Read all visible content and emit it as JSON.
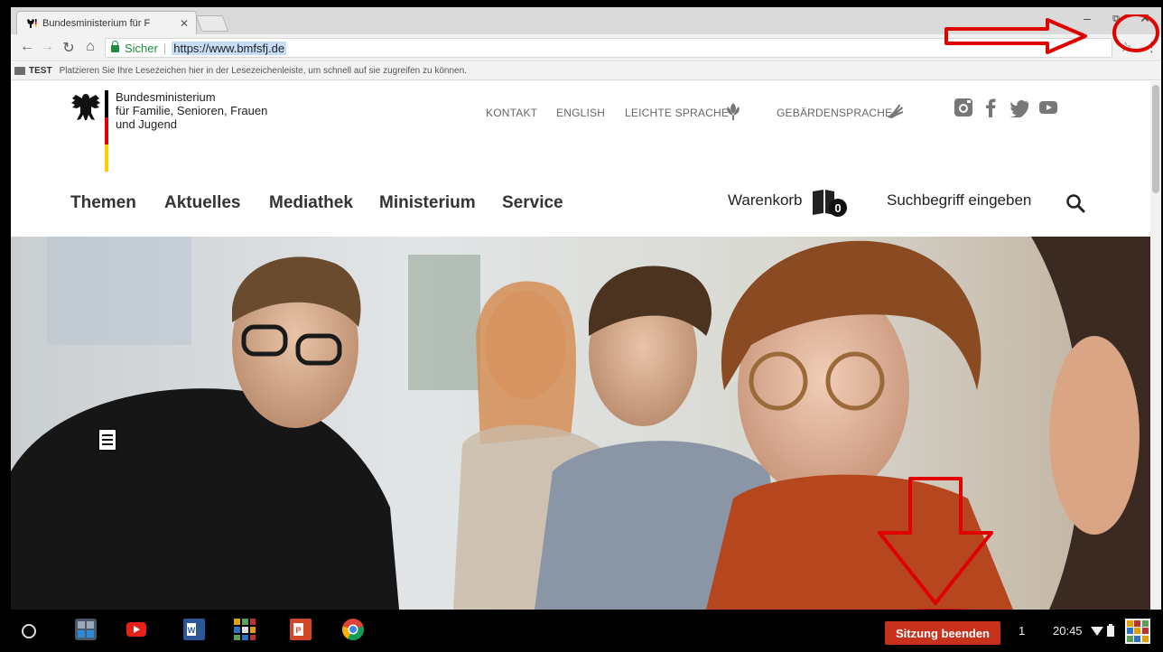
{
  "browser": {
    "tab_title": "Bundesministerium für F",
    "omnibox_secure": "Sicher",
    "omnibox_url": "https://www.bmfsfj.de",
    "bookmark_folder": "TEST",
    "bookmark_hint": "Platzieren Sie Ihre Lesezeichen hier in der Lesezeichenleiste, um schnell auf sie zugreifen zu können."
  },
  "site": {
    "ministry_lines": [
      "Bundesministerium",
      "für Familie, Senioren, Frauen",
      "und Jugend"
    ],
    "topnav": [
      "KONTAKT",
      "ENGLISH",
      "LEICHTE SPRACHE",
      "GEBÄRDENSPRACHE"
    ],
    "social_icons": [
      "instagram-icon",
      "facebook-icon",
      "twitter-icon",
      "youtube-icon"
    ],
    "mainnav": [
      "Themen",
      "Aktuelles",
      "Mediathek",
      "Ministerium",
      "Service"
    ],
    "cart_label": "Warenkorb",
    "cart_count": "0",
    "search_placeholder": "Suchbegriff eingeben",
    "flag_colors": [
      "#000000",
      "#dd0000",
      "#ffcc00"
    ]
  },
  "taskbar": {
    "apps": [
      "calculator-icon",
      "youtube-icon",
      "word-icon",
      "app-grid-icon",
      "powerpoint-icon",
      "chrome-icon"
    ],
    "session_button": "Sitzung beenden",
    "notification_count": "1",
    "time": "20:45"
  },
  "colors": {
    "annotation_red": "#e00000",
    "session_red": "#c8321d",
    "secure_green": "#1e8e3e"
  }
}
